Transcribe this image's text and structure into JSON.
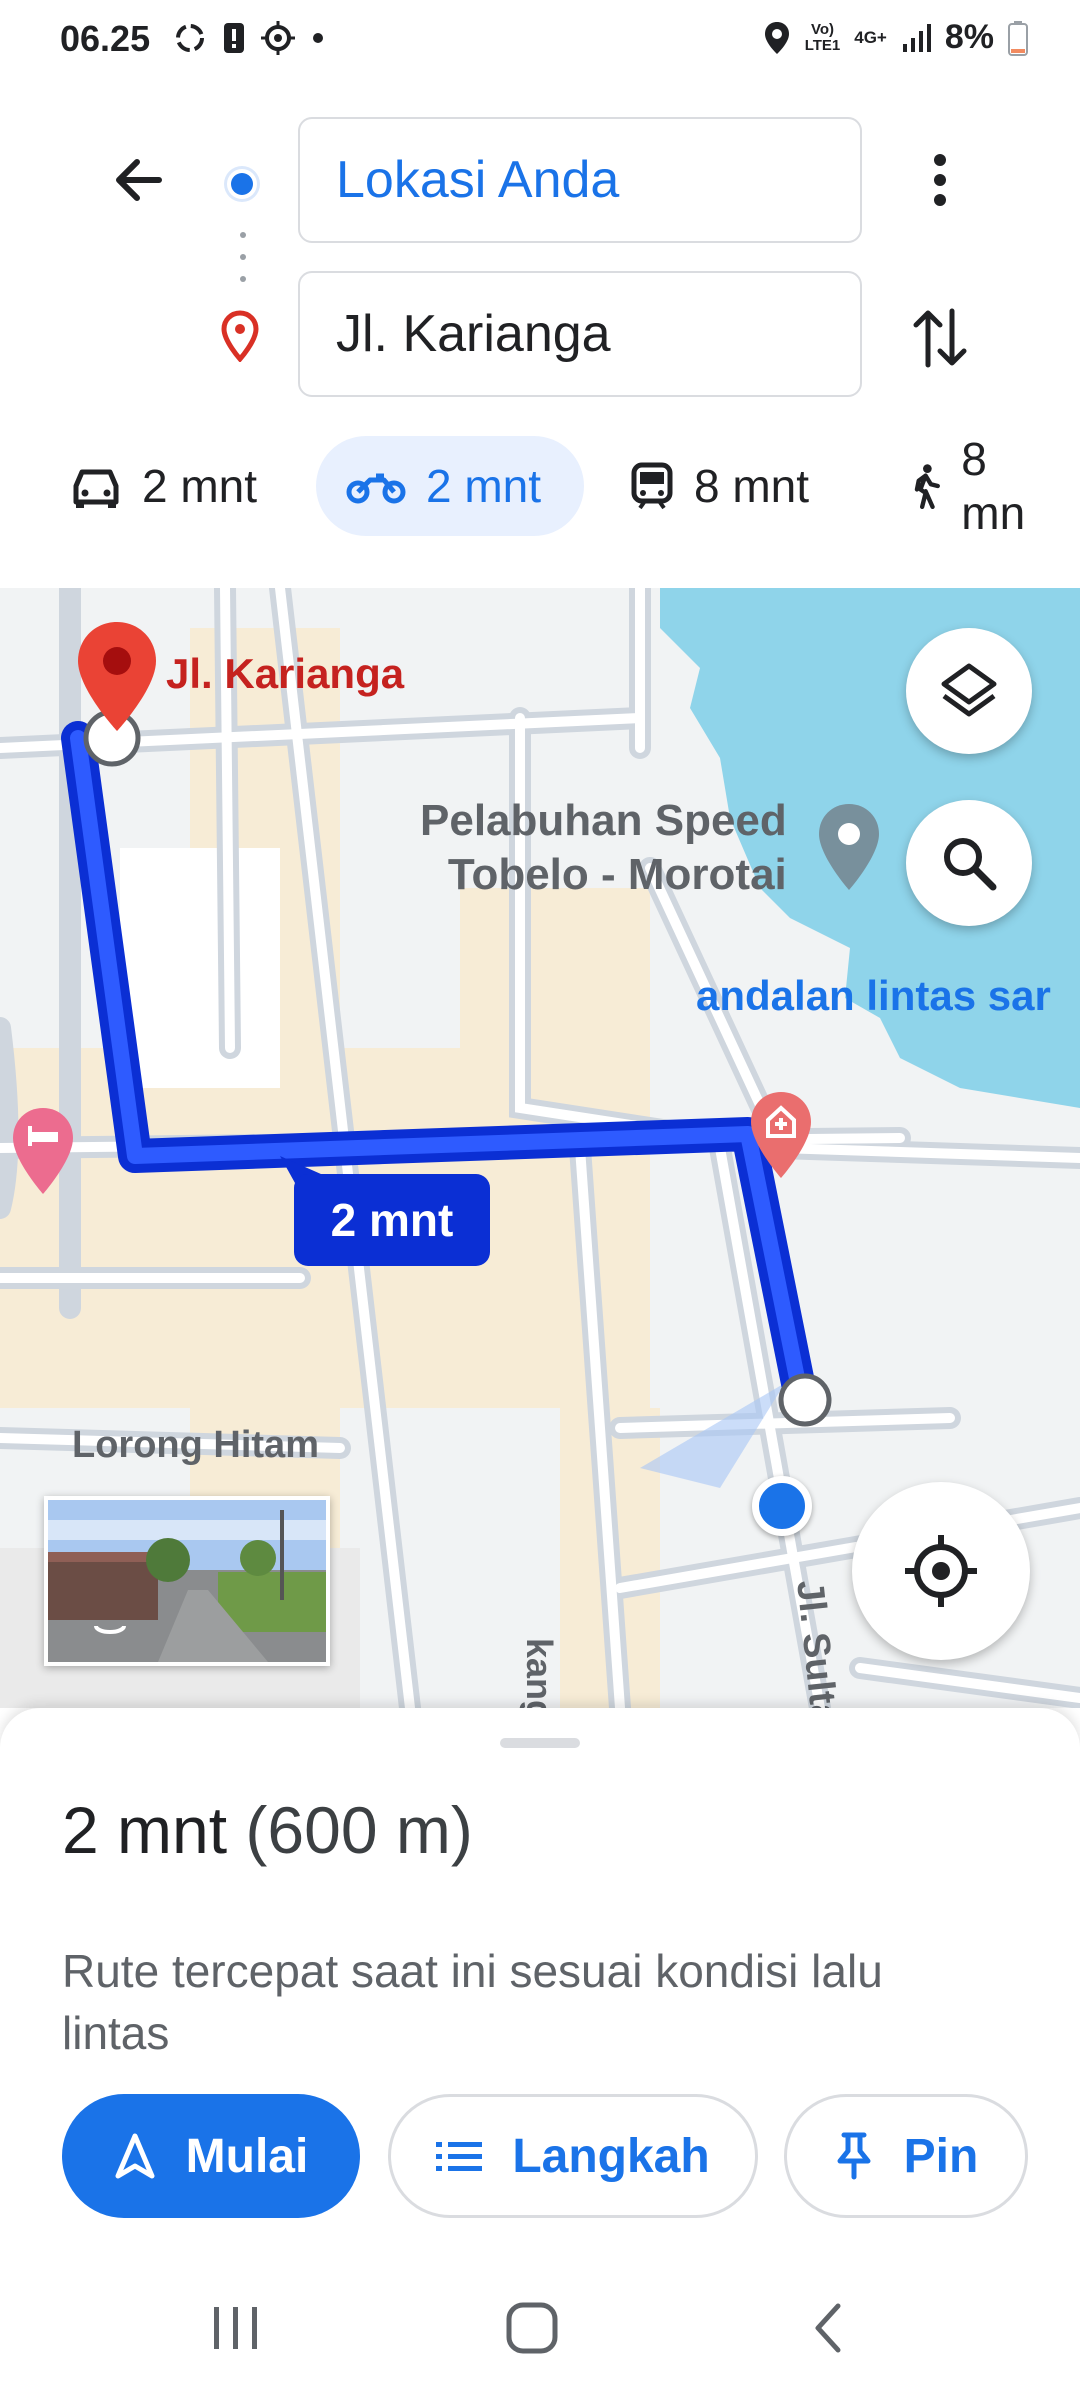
{
  "status_bar": {
    "time": "06.25",
    "network_top": "Vo)",
    "network_bottom": "LTE1",
    "network_type": "4G+",
    "battery": "8%",
    "icons": [
      "sync-icon",
      "alert-icon",
      "target-icon",
      "dot-icon",
      "location-icon",
      "signal-icon",
      "battery-icon"
    ]
  },
  "directions": {
    "origin": "Lokasi Anda",
    "destination": "Jl. Karianga",
    "colors": {
      "accent": "#1a73e8",
      "destination_pin": "#d93025"
    }
  },
  "modes": [
    {
      "name": "car",
      "label": "2 mnt",
      "icon": "car-icon"
    },
    {
      "name": "motorcycle",
      "label": "2 mnt",
      "icon": "motorcycle-icon",
      "selected": true
    },
    {
      "name": "transit",
      "label": "8 mnt",
      "icon": "train-icon"
    },
    {
      "name": "walk",
      "label": "8 mn",
      "icon": "walk-icon"
    }
  ],
  "map": {
    "destination_label": "Jl. Karianga",
    "poi_port": "Pelabuhan Speed\nTobelo - Morotai",
    "poi_blue": "andalan lintas sar",
    "street_lorong": "Lorong Hitam",
    "street_sultan": "Jl. Sulta",
    "street_kang": "kang",
    "route_badge": "2 mnt",
    "route_color": "#0b2fd4",
    "water_color": "#8fd4ea"
  },
  "sheet": {
    "duration": "2 mnt",
    "distance": "(600 m)",
    "description": "Rute tercepat saat ini sesuai kondisi lalu lintas",
    "start_label": "Mulai",
    "steps_label": "Langkah",
    "pin_label": "Pin"
  }
}
